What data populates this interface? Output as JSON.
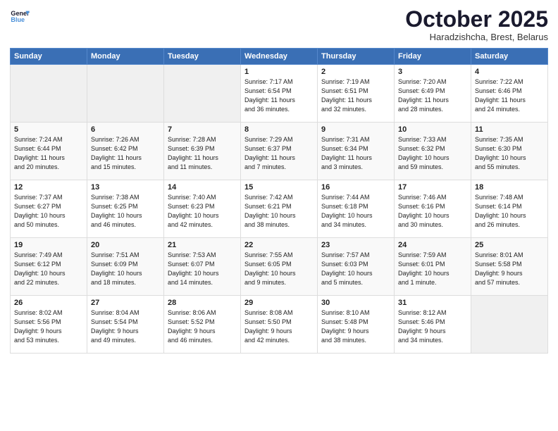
{
  "logo": {
    "line1": "General",
    "line2": "Blue"
  },
  "title": "October 2025",
  "subtitle": "Haradzishcha, Brest, Belarus",
  "headers": [
    "Sunday",
    "Monday",
    "Tuesday",
    "Wednesday",
    "Thursday",
    "Friday",
    "Saturday"
  ],
  "weeks": [
    [
      {
        "day": "",
        "info": ""
      },
      {
        "day": "",
        "info": ""
      },
      {
        "day": "",
        "info": ""
      },
      {
        "day": "1",
        "info": "Sunrise: 7:17 AM\nSunset: 6:54 PM\nDaylight: 11 hours\nand 36 minutes."
      },
      {
        "day": "2",
        "info": "Sunrise: 7:19 AM\nSunset: 6:51 PM\nDaylight: 11 hours\nand 32 minutes."
      },
      {
        "day": "3",
        "info": "Sunrise: 7:20 AM\nSunset: 6:49 PM\nDaylight: 11 hours\nand 28 minutes."
      },
      {
        "day": "4",
        "info": "Sunrise: 7:22 AM\nSunset: 6:46 PM\nDaylight: 11 hours\nand 24 minutes."
      }
    ],
    [
      {
        "day": "5",
        "info": "Sunrise: 7:24 AM\nSunset: 6:44 PM\nDaylight: 11 hours\nand 20 minutes."
      },
      {
        "day": "6",
        "info": "Sunrise: 7:26 AM\nSunset: 6:42 PM\nDaylight: 11 hours\nand 15 minutes."
      },
      {
        "day": "7",
        "info": "Sunrise: 7:28 AM\nSunset: 6:39 PM\nDaylight: 11 hours\nand 11 minutes."
      },
      {
        "day": "8",
        "info": "Sunrise: 7:29 AM\nSunset: 6:37 PM\nDaylight: 11 hours\nand 7 minutes."
      },
      {
        "day": "9",
        "info": "Sunrise: 7:31 AM\nSunset: 6:34 PM\nDaylight: 11 hours\nand 3 minutes."
      },
      {
        "day": "10",
        "info": "Sunrise: 7:33 AM\nSunset: 6:32 PM\nDaylight: 10 hours\nand 59 minutes."
      },
      {
        "day": "11",
        "info": "Sunrise: 7:35 AM\nSunset: 6:30 PM\nDaylight: 10 hours\nand 55 minutes."
      }
    ],
    [
      {
        "day": "12",
        "info": "Sunrise: 7:37 AM\nSunset: 6:27 PM\nDaylight: 10 hours\nand 50 minutes."
      },
      {
        "day": "13",
        "info": "Sunrise: 7:38 AM\nSunset: 6:25 PM\nDaylight: 10 hours\nand 46 minutes."
      },
      {
        "day": "14",
        "info": "Sunrise: 7:40 AM\nSunset: 6:23 PM\nDaylight: 10 hours\nand 42 minutes."
      },
      {
        "day": "15",
        "info": "Sunrise: 7:42 AM\nSunset: 6:21 PM\nDaylight: 10 hours\nand 38 minutes."
      },
      {
        "day": "16",
        "info": "Sunrise: 7:44 AM\nSunset: 6:18 PM\nDaylight: 10 hours\nand 34 minutes."
      },
      {
        "day": "17",
        "info": "Sunrise: 7:46 AM\nSunset: 6:16 PM\nDaylight: 10 hours\nand 30 minutes."
      },
      {
        "day": "18",
        "info": "Sunrise: 7:48 AM\nSunset: 6:14 PM\nDaylight: 10 hours\nand 26 minutes."
      }
    ],
    [
      {
        "day": "19",
        "info": "Sunrise: 7:49 AM\nSunset: 6:12 PM\nDaylight: 10 hours\nand 22 minutes."
      },
      {
        "day": "20",
        "info": "Sunrise: 7:51 AM\nSunset: 6:09 PM\nDaylight: 10 hours\nand 18 minutes."
      },
      {
        "day": "21",
        "info": "Sunrise: 7:53 AM\nSunset: 6:07 PM\nDaylight: 10 hours\nand 14 minutes."
      },
      {
        "day": "22",
        "info": "Sunrise: 7:55 AM\nSunset: 6:05 PM\nDaylight: 10 hours\nand 9 minutes."
      },
      {
        "day": "23",
        "info": "Sunrise: 7:57 AM\nSunset: 6:03 PM\nDaylight: 10 hours\nand 5 minutes."
      },
      {
        "day": "24",
        "info": "Sunrise: 7:59 AM\nSunset: 6:01 PM\nDaylight: 10 hours\nand 1 minute."
      },
      {
        "day": "25",
        "info": "Sunrise: 8:01 AM\nSunset: 5:58 PM\nDaylight: 9 hours\nand 57 minutes."
      }
    ],
    [
      {
        "day": "26",
        "info": "Sunrise: 8:02 AM\nSunset: 5:56 PM\nDaylight: 9 hours\nand 53 minutes."
      },
      {
        "day": "27",
        "info": "Sunrise: 8:04 AM\nSunset: 5:54 PM\nDaylight: 9 hours\nand 49 minutes."
      },
      {
        "day": "28",
        "info": "Sunrise: 8:06 AM\nSunset: 5:52 PM\nDaylight: 9 hours\nand 46 minutes."
      },
      {
        "day": "29",
        "info": "Sunrise: 8:08 AM\nSunset: 5:50 PM\nDaylight: 9 hours\nand 42 minutes."
      },
      {
        "day": "30",
        "info": "Sunrise: 8:10 AM\nSunset: 5:48 PM\nDaylight: 9 hours\nand 38 minutes."
      },
      {
        "day": "31",
        "info": "Sunrise: 8:12 AM\nSunset: 5:46 PM\nDaylight: 9 hours\nand 34 minutes."
      },
      {
        "day": "",
        "info": ""
      }
    ]
  ]
}
